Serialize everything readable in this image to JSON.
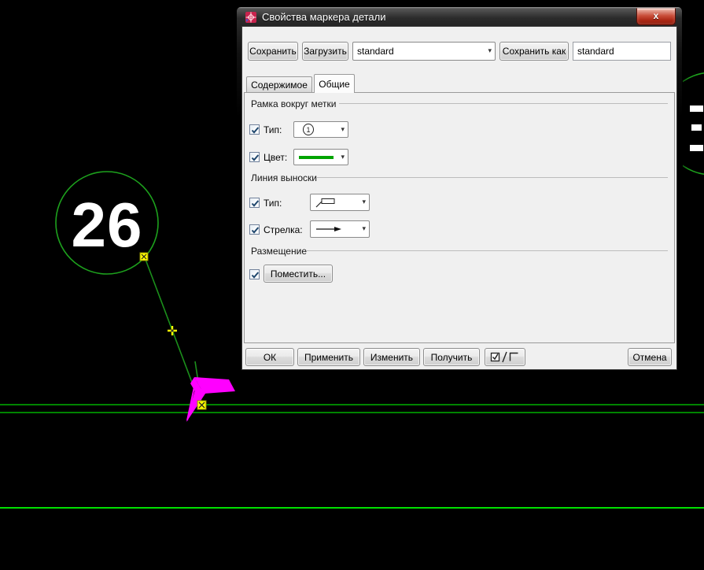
{
  "window": {
    "title": "Свойства маркера детали",
    "close": "x"
  },
  "toolbar": {
    "save": "Сохранить",
    "load": "Загрузить",
    "preset": "standard",
    "save_as": "Сохранить как",
    "preset_name": "standard"
  },
  "tabs": {
    "content": "Содержимое",
    "general": "Общие"
  },
  "frame_group": {
    "title": "Рамка вокруг метки",
    "type_label": "Тип:",
    "type_value": "1",
    "color_label": "Цвет:"
  },
  "leader_group": {
    "title": "Линия выноски",
    "type_label": "Тип:",
    "arrow_label": "Стрелка:"
  },
  "placement_group": {
    "title": "Размещение",
    "place": "Поместить..."
  },
  "footer": {
    "ok": "ОК",
    "apply": "Применить",
    "change": "Изменить",
    "get": "Получить",
    "cancel": "Отмена"
  },
  "icons": {
    "dropdown_arrow": "▾"
  },
  "canvas": {
    "balloon_text": "26",
    "colors": {
      "balloon": "#1da11d",
      "leader": "#1b8f1b",
      "section": "#00d400",
      "bright_section": "#00e000",
      "arrow": "#ff00ff",
      "grip": "#ffff00",
      "text": "#ffffff",
      "swatch": "#00a400"
    }
  }
}
